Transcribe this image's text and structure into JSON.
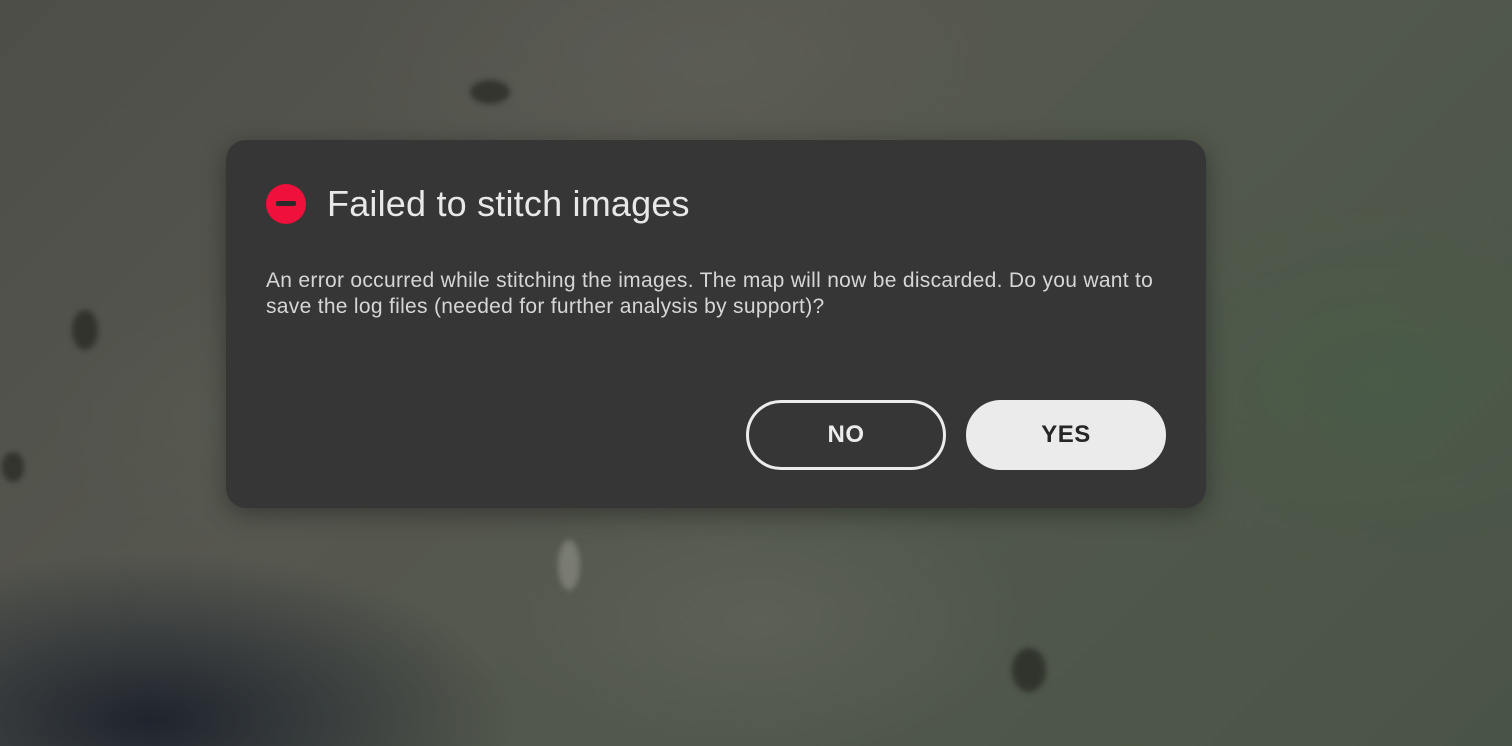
{
  "dialog": {
    "icon": "error-minus-circle-icon",
    "icon_color": "#f0103c",
    "title": "Failed to stitch images",
    "message": "An error occurred while stitching the images. The map will now be discarded. Do you want to save the log files (needed for further analysis by support)?",
    "no_label": "NO",
    "yes_label": "YES",
    "background_color": "#363636"
  }
}
